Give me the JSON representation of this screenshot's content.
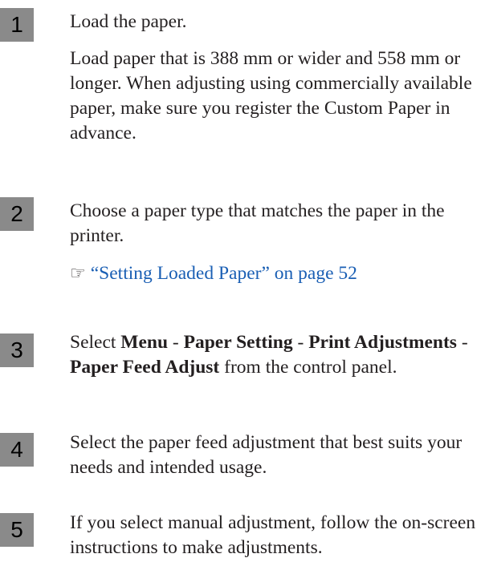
{
  "steps": [
    {
      "number": "1",
      "text": "Load the paper.",
      "detail": "Load paper that is 388 mm or wider and 558 mm or longer. When adjusting using commercially available paper, make sure you register the Custom Paper in advance."
    },
    {
      "number": "2",
      "text": "Choose a paper type that matches the paper in the printer.",
      "link_icon": "reference-arrow-icon",
      "link_text": "“Setting Loaded Paper” on page 52"
    },
    {
      "number": "3",
      "parts": [
        "Select ",
        "Menu",
        " - ",
        "Paper Setting",
        " - ",
        "Print Adjustments",
        " - ",
        "Paper Feed Adjust",
        " from the control panel."
      ]
    },
    {
      "number": "4",
      "text": "Select the paper feed adjustment that best suits your needs and intended usage."
    },
    {
      "number": "5",
      "text": "If you select manual adjustment, follow the on-screen instructions to make adjustments."
    }
  ]
}
